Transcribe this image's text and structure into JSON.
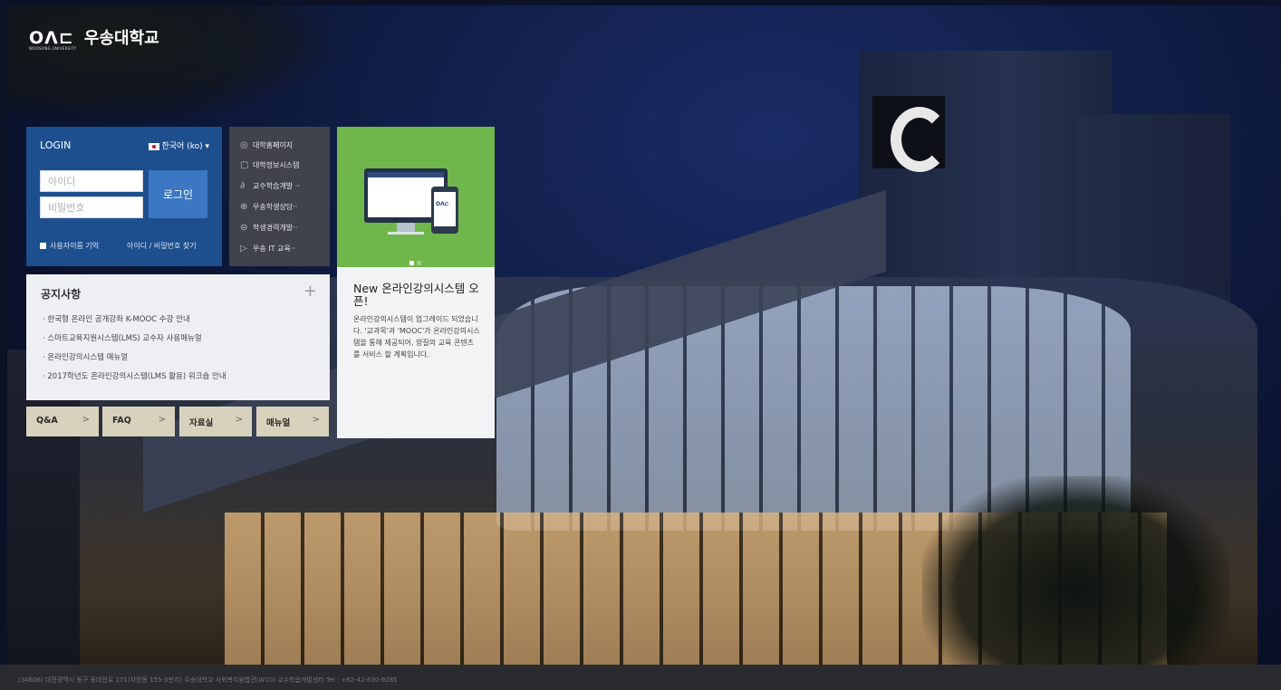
{
  "header": {
    "logo_mark": "ОΛ⊏",
    "logo_name": "우송대학교",
    "logo_sub": "WOOSONG UNIVERSITY"
  },
  "login": {
    "title": "LOGIN",
    "language": "한국어 (ko) ▾",
    "id_placeholder": "아이디",
    "pw_placeholder": "비밀번호",
    "submit_label": "로그인",
    "remember_label": "사용자이름 기억",
    "find_label": "아이디 / 비밀번호 찾기"
  },
  "quick_links": [
    {
      "label": "대학홈페이지",
      "icon": "layers-icon"
    },
    {
      "label": "대학정보시스템",
      "icon": "document-icon"
    },
    {
      "label": "교수학습개발 ··",
      "icon": "link-icon"
    },
    {
      "label": "우송학생상담··",
      "icon": "compass-icon"
    },
    {
      "label": "학생경력개발··",
      "icon": "globe-icon"
    },
    {
      "label": "우송 IT 교육··",
      "icon": "play-icon"
    }
  ],
  "notice": {
    "title": "공지사항",
    "more": "+",
    "items": [
      "· 한국형 온라인 공개강좌 K-MOOC 수강 안내",
      "· 스마트교육지원시스템(LMS) 교수자 사용매뉴얼",
      "· 온라인강의시스템 매뉴얼",
      "· 2017학년도 온라인강의시스템(LMS 활용) 워크숍 안내"
    ]
  },
  "tiles": [
    {
      "label": "Q&A",
      "chevron": ">"
    },
    {
      "label": "FAQ",
      "chevron": ">"
    },
    {
      "label": "자료실",
      "chevron": ">"
    },
    {
      "label": "매뉴얼",
      "chevron": ">"
    }
  ],
  "promo": {
    "title": "New 온라인강의시스템 오픈!",
    "body": "온라인강의시스템이 업그레이드 되었습니다. '교과목'과 'MOOC'가 온라인강의시스템을 통해 제공되어, 양질의 교육 콘텐츠를 서비스 할 계획입니다.",
    "phone_logo": "ОΛ⊏"
  },
  "footer": {
    "address": "(34606) 대전광역시 동구 동대전로 171(자양동 155-3번지) 우송대학교 사회복지융합관(W10) 교수학습개발센터   Tel : +82-42-630-9285"
  },
  "colors": {
    "login_blue": "#1d4f8f",
    "button_blue": "#3b77c2",
    "promo_green": "#6fb74b",
    "tile_beige": "#d8d2bc"
  }
}
